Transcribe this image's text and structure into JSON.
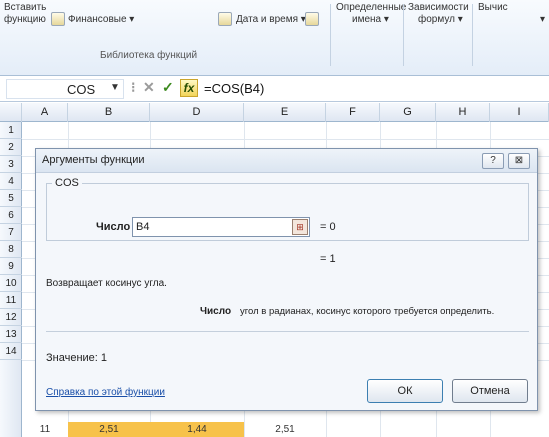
{
  "ribbon": {
    "insert_function_line1": "Вставить",
    "insert_function_line2": "функцию",
    "financial": "Финансовые ▾",
    "datetime": "Дата и время ▾",
    "defined_names_line1": "Определенные",
    "defined_names_line2": "имена ▾",
    "dependencies_line1": "Зависимости",
    "dependencies_line2": "формул ▾",
    "calc_line1": "Вычис",
    "calc_line2": "▾",
    "group_label": "Библиотека функций"
  },
  "formula_bar": {
    "name_box": "COS",
    "fx": "fx",
    "formula": "=COS(B4)"
  },
  "grid": {
    "columns": [
      "A",
      "B",
      "D",
      "E",
      "F",
      "G",
      "H",
      "I"
    ],
    "rows": [
      "1",
      "2",
      "3",
      "4",
      "5",
      "6",
      "7",
      "8",
      "9",
      "10",
      "11",
      "12",
      "13",
      "14"
    ],
    "row14": {
      "a": "11",
      "b": "2,51",
      "d": "1,44",
      "e": "2,51"
    }
  },
  "dialog": {
    "title": "Аргументы функции",
    "help_btn": "?",
    "close_btn": "⊠",
    "function_name": "COS",
    "arg_label": "Число",
    "arg_value": "B4",
    "arg_result": "= 0",
    "formula_result": "= 1",
    "description": "Возвращает косинус угла.",
    "arg_desc_label": "Число",
    "arg_desc": "угол в радианах, косинус которого требуется определить.",
    "value_line": "Значение:  1",
    "help_link": "Справка по этой функции",
    "ok_label": "ОК",
    "cancel_label": "Отмена"
  }
}
